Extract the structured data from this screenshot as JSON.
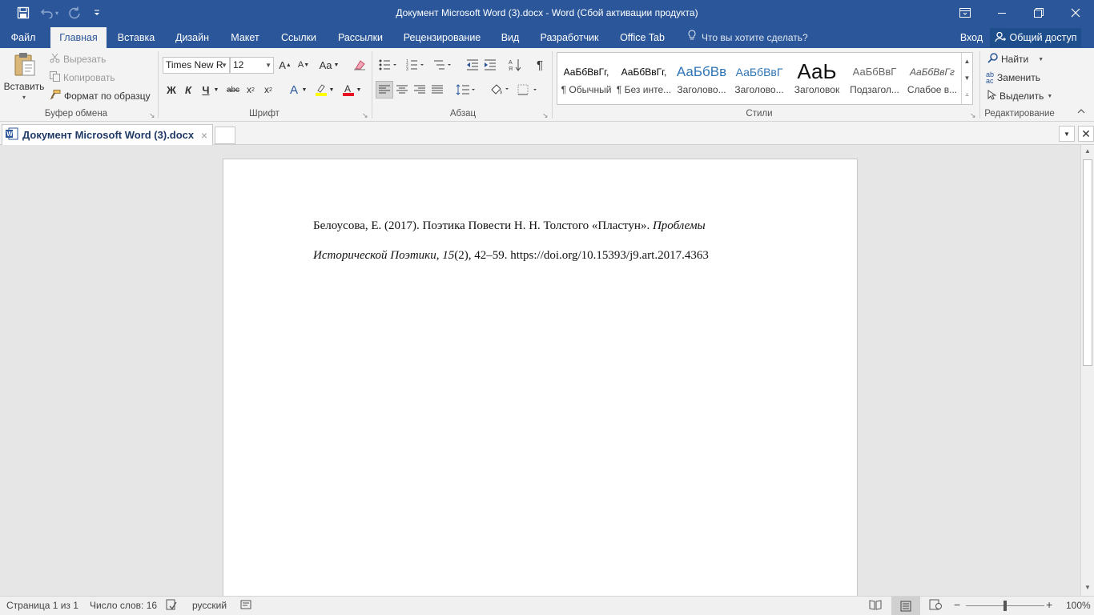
{
  "window": {
    "title": "Документ Microsoft Word (3).docx  -  Word (Сбой активации продукта)"
  },
  "qat": {
    "save_icon": "save-icon",
    "undo_icon": "undo-icon",
    "redo_icon": "redo-icon",
    "customize_icon": "chevron-down-icon"
  },
  "tabs": [
    {
      "label": "Файл"
    },
    {
      "label": "Главная"
    },
    {
      "label": "Вставка"
    },
    {
      "label": "Дизайн"
    },
    {
      "label": "Макет"
    },
    {
      "label": "Ссылки"
    },
    {
      "label": "Рассылки"
    },
    {
      "label": "Рецензирование"
    },
    {
      "label": "Вид"
    },
    {
      "label": "Разработчик"
    },
    {
      "label": "Office Tab"
    }
  ],
  "tell_me": "Что вы хотите сделать?",
  "signin": "Вход",
  "share": "Общий доступ",
  "clipboard": {
    "paste": "Вставить",
    "cut": "Вырезать",
    "copy": "Копировать",
    "format_painter": "Формат по образцу",
    "label": "Буфер обмена"
  },
  "font": {
    "name": "Times New R",
    "size": "12",
    "label": "Шрифт",
    "bold": "Ж",
    "italic": "К",
    "underline": "Ч",
    "strike": "abc",
    "change_case": "Aa"
  },
  "paragraph": {
    "label": "Абзац"
  },
  "styles": {
    "label": "Стили",
    "items": [
      {
        "sample": "АаБбВвГг,",
        "name": "¶ Обычный"
      },
      {
        "sample": "АаБбВвГг,",
        "name": "¶ Без инте..."
      },
      {
        "sample": "АаБбВв",
        "name": "Заголово..."
      },
      {
        "sample": "АаБбВвГ",
        "name": "Заголово..."
      },
      {
        "sample": "АаЬ",
        "name": "Заголовок"
      },
      {
        "sample": "АаБбВвГ",
        "name": "Подзагол..."
      },
      {
        "sample": "АаБбВвГг",
        "name": "Слабое в..."
      }
    ]
  },
  "editing": {
    "find": "Найти",
    "replace": "Заменить",
    "select": "Выделить",
    "label": "Редактирование"
  },
  "doc_tab": {
    "name": "Документ Microsoft Word (3).docx",
    "close": "×"
  },
  "document": {
    "line1_plain": "Белоусова, Е. (2017). Поэтика Повести Н. Н. Толстого «Пластун». ",
    "line1_italic": "Проблемы",
    "line2_italic1": "Исторической Поэтики",
    "line2_plain1": ", ",
    "line2_italic2": "15",
    "line2_plain2": "(2), 42–59. https://doi.org/10.15393/j9.art.2017.4363"
  },
  "status": {
    "page": "Страница 1 из 1",
    "words": "Число слов: 16",
    "language": "русский",
    "zoom": "100%",
    "zoom_level": 1.0
  },
  "colors": {
    "accent": "#2b579a",
    "highlight": "#ffff00",
    "font_color": "#e81123"
  }
}
